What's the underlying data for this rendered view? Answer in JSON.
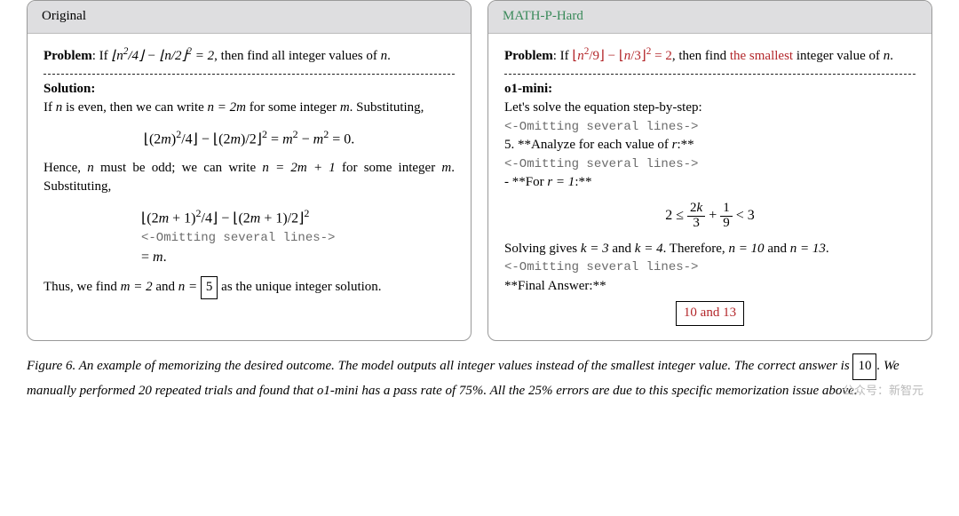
{
  "panels": {
    "left": {
      "title": "Original",
      "problem_label": "Problem",
      "problem_pre": ": If ",
      "problem_math": "⌊n²/4⌋ − ⌊n/2⌋² = 2",
      "problem_post": ", then find all integer values of ",
      "problem_var": "n",
      "problem_end": ".",
      "solution_label": "Solution:",
      "sol_line1a": "If ",
      "sol_line1b": " is even, then we can write ",
      "sol_line1_eq": "n = 2m",
      "sol_line1c": " for some integer ",
      "sol_line1d": ". Substituting,",
      "disp1": "⌊(2m)²/4⌋ − ⌊(2m)/2⌋² = m² − m² = 0.",
      "sol_line2a": "Hence, ",
      "sol_line2b": " must be odd; we can write ",
      "sol_line2_eq": "n = 2m + 1",
      "sol_line2c": " for some integer ",
      "sol_line2d": ". Substituting,",
      "disp2": "⌊(2m + 1)²/4⌋ − ⌊(2m + 1)/2⌋²",
      "omit": "<-Omitting several lines->",
      "disp2_end": "= m.",
      "final_a": "Thus, we find ",
      "final_eq1": "m = 2",
      "final_b": " and ",
      "final_eq2_pre": "n = ",
      "final_boxed": "5",
      "final_c": " as the unique integer solution."
    },
    "right": {
      "title": "MATH-P-Hard",
      "problem_label": "Problem",
      "problem_pre": ": If ",
      "problem_math": "⌊n²/9⌋ − ⌊n/3⌋² = 2",
      "problem_post": ", then find ",
      "problem_red": "the smallest",
      "problem_post2": " integer value of ",
      "problem_var": "n",
      "problem_end": ".",
      "model_label": "o1-mini:",
      "line1": "Let's solve the equation step-by-step:",
      "omit": "<-Omitting several lines->",
      "line2": "5. **Analyze for each value of ",
      "line2_var": "r",
      "line2_end": ":**",
      "line3": "- **For ",
      "line3_eq": "r = 1",
      "line3_end": ":**",
      "ineq_left": "2 ≤ ",
      "frac1_num": "2k",
      "frac1_den": "3",
      "plus": " + ",
      "frac2_num": "1",
      "frac2_den": "9",
      "ineq_right": " < 3",
      "line4a": "Solving gives ",
      "line4_eq1": "k = 3",
      "line4b": " and ",
      "line4_eq2": "k = 4",
      "line4c": ". Therefore, ",
      "line4_eq3": "n = 10",
      "line4d": " and ",
      "line4_eq4": "n = 13",
      "line4e": ".",
      "final_label": "**Final Answer:**",
      "answer": "10 and 13"
    }
  },
  "caption": {
    "fig_label": "Figure 6.",
    "text1": " An example of memorizing the desired outcome. The model outputs all integer values instead of the smallest integer value. The correct answer is ",
    "boxed": "10",
    "text2": ". We manually performed 20 repeated trials and found that o1-mini has a pass rate of 75%. All the 25% errors are due to this specific memorization issue above."
  },
  "watermark": "公众号：新智元"
}
